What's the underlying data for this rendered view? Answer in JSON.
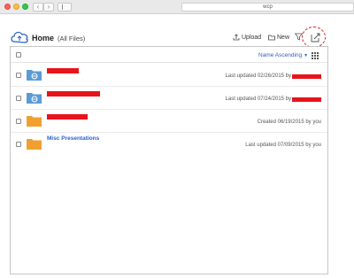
{
  "browser": {
    "back_glyph": "‹",
    "forward_glyph": "›",
    "url": "wcp"
  },
  "header": {
    "title": "Home",
    "subtitle": "(All Files)",
    "upload_label": "Upload",
    "new_label": "New",
    "filter_icon": "filter-icon",
    "share_icon": "share-icon",
    "upload_icon": "upload-icon",
    "new_icon": "new-folder-icon"
  },
  "list": {
    "sort_label": "Name Ascending",
    "view_icon": "grid-view-icon",
    "rows": [
      {
        "name": "",
        "redacted_name": true,
        "folder_type": "shared",
        "meta": "Last updated 02/26/2015 by",
        "meta_redacted": true
      },
      {
        "name": "",
        "redacted_name": true,
        "folder_type": "shared",
        "meta": "Last updated 07/24/2015 by",
        "meta_redacted": true
      },
      {
        "name": "",
        "redacted_name": true,
        "folder_type": "personal",
        "meta": "Created 06/19/2015 by you",
        "meta_redacted": false
      },
      {
        "name": "Misc Presentations",
        "redacted_name": false,
        "folder_type": "personal",
        "meta": "Last updated 07/09/2015 by you",
        "meta_redacted": false
      }
    ]
  },
  "colors": {
    "accent": "#2a63c7",
    "shared_folder": "#5b9bd5",
    "personal_folder": "#f0a030",
    "redaction": "#e8141c",
    "highlight_circle": "#e02020"
  }
}
